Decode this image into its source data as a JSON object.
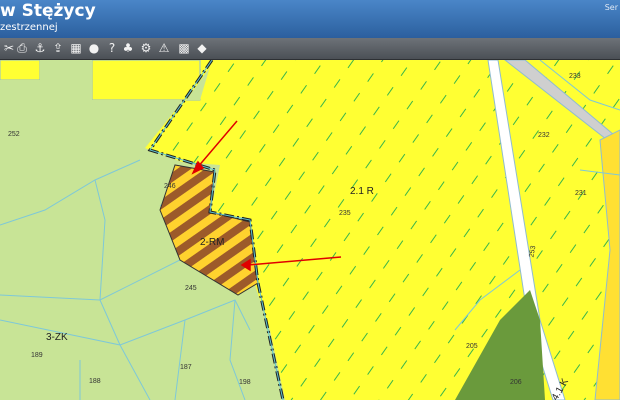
{
  "header": {
    "title": "w Stężycy",
    "subtitle": "zestrzennej",
    "corner_text": "Ser"
  },
  "toolbar": {
    "tools": [
      {
        "icon": "ruler-icon",
        "glyph": "✂"
      },
      {
        "icon": "print-icon",
        "glyph": "⎙"
      },
      {
        "icon": "anchor-icon",
        "glyph": "⚓"
      },
      {
        "icon": "export-icon",
        "glyph": "⇪"
      },
      {
        "icon": "layout-icon",
        "glyph": "▦"
      },
      {
        "icon": "speech-bubble-icon",
        "glyph": "●"
      },
      {
        "icon": "help-icon",
        "glyph": "?"
      },
      {
        "icon": "tree-icon",
        "glyph": "♣"
      },
      {
        "icon": "settings-icon",
        "glyph": "⚙"
      },
      {
        "icon": "warning-icon",
        "glyph": "⚠"
      },
      {
        "icon": "grid-icon",
        "glyph": "▩"
      },
      {
        "icon": "layers-icon",
        "glyph": "◆"
      }
    ]
  },
  "map": {
    "colors": {
      "agricultural": "#ffff33",
      "forest": "#c8e496",
      "residential_hatch": "#9c5a2a",
      "meadow": "#6a9a3c",
      "road": "#ffffff",
      "boundary": "#333333",
      "arrow": "#e00000"
    },
    "zones": [
      {
        "id": "zone-2-1-r",
        "label": "2.1 R"
      },
      {
        "id": "zone-2-rm",
        "label": "2-RM"
      },
      {
        "id": "zone-3-zk",
        "label": "3-ZK"
      },
      {
        "id": "zone-4-1",
        "label": "4.1 K"
      }
    ],
    "parcels": [
      "252",
      "246",
      "245",
      "235",
      "233",
      "232",
      "231",
      "253",
      "205",
      "206",
      "189",
      "188",
      "187",
      "198"
    ]
  }
}
